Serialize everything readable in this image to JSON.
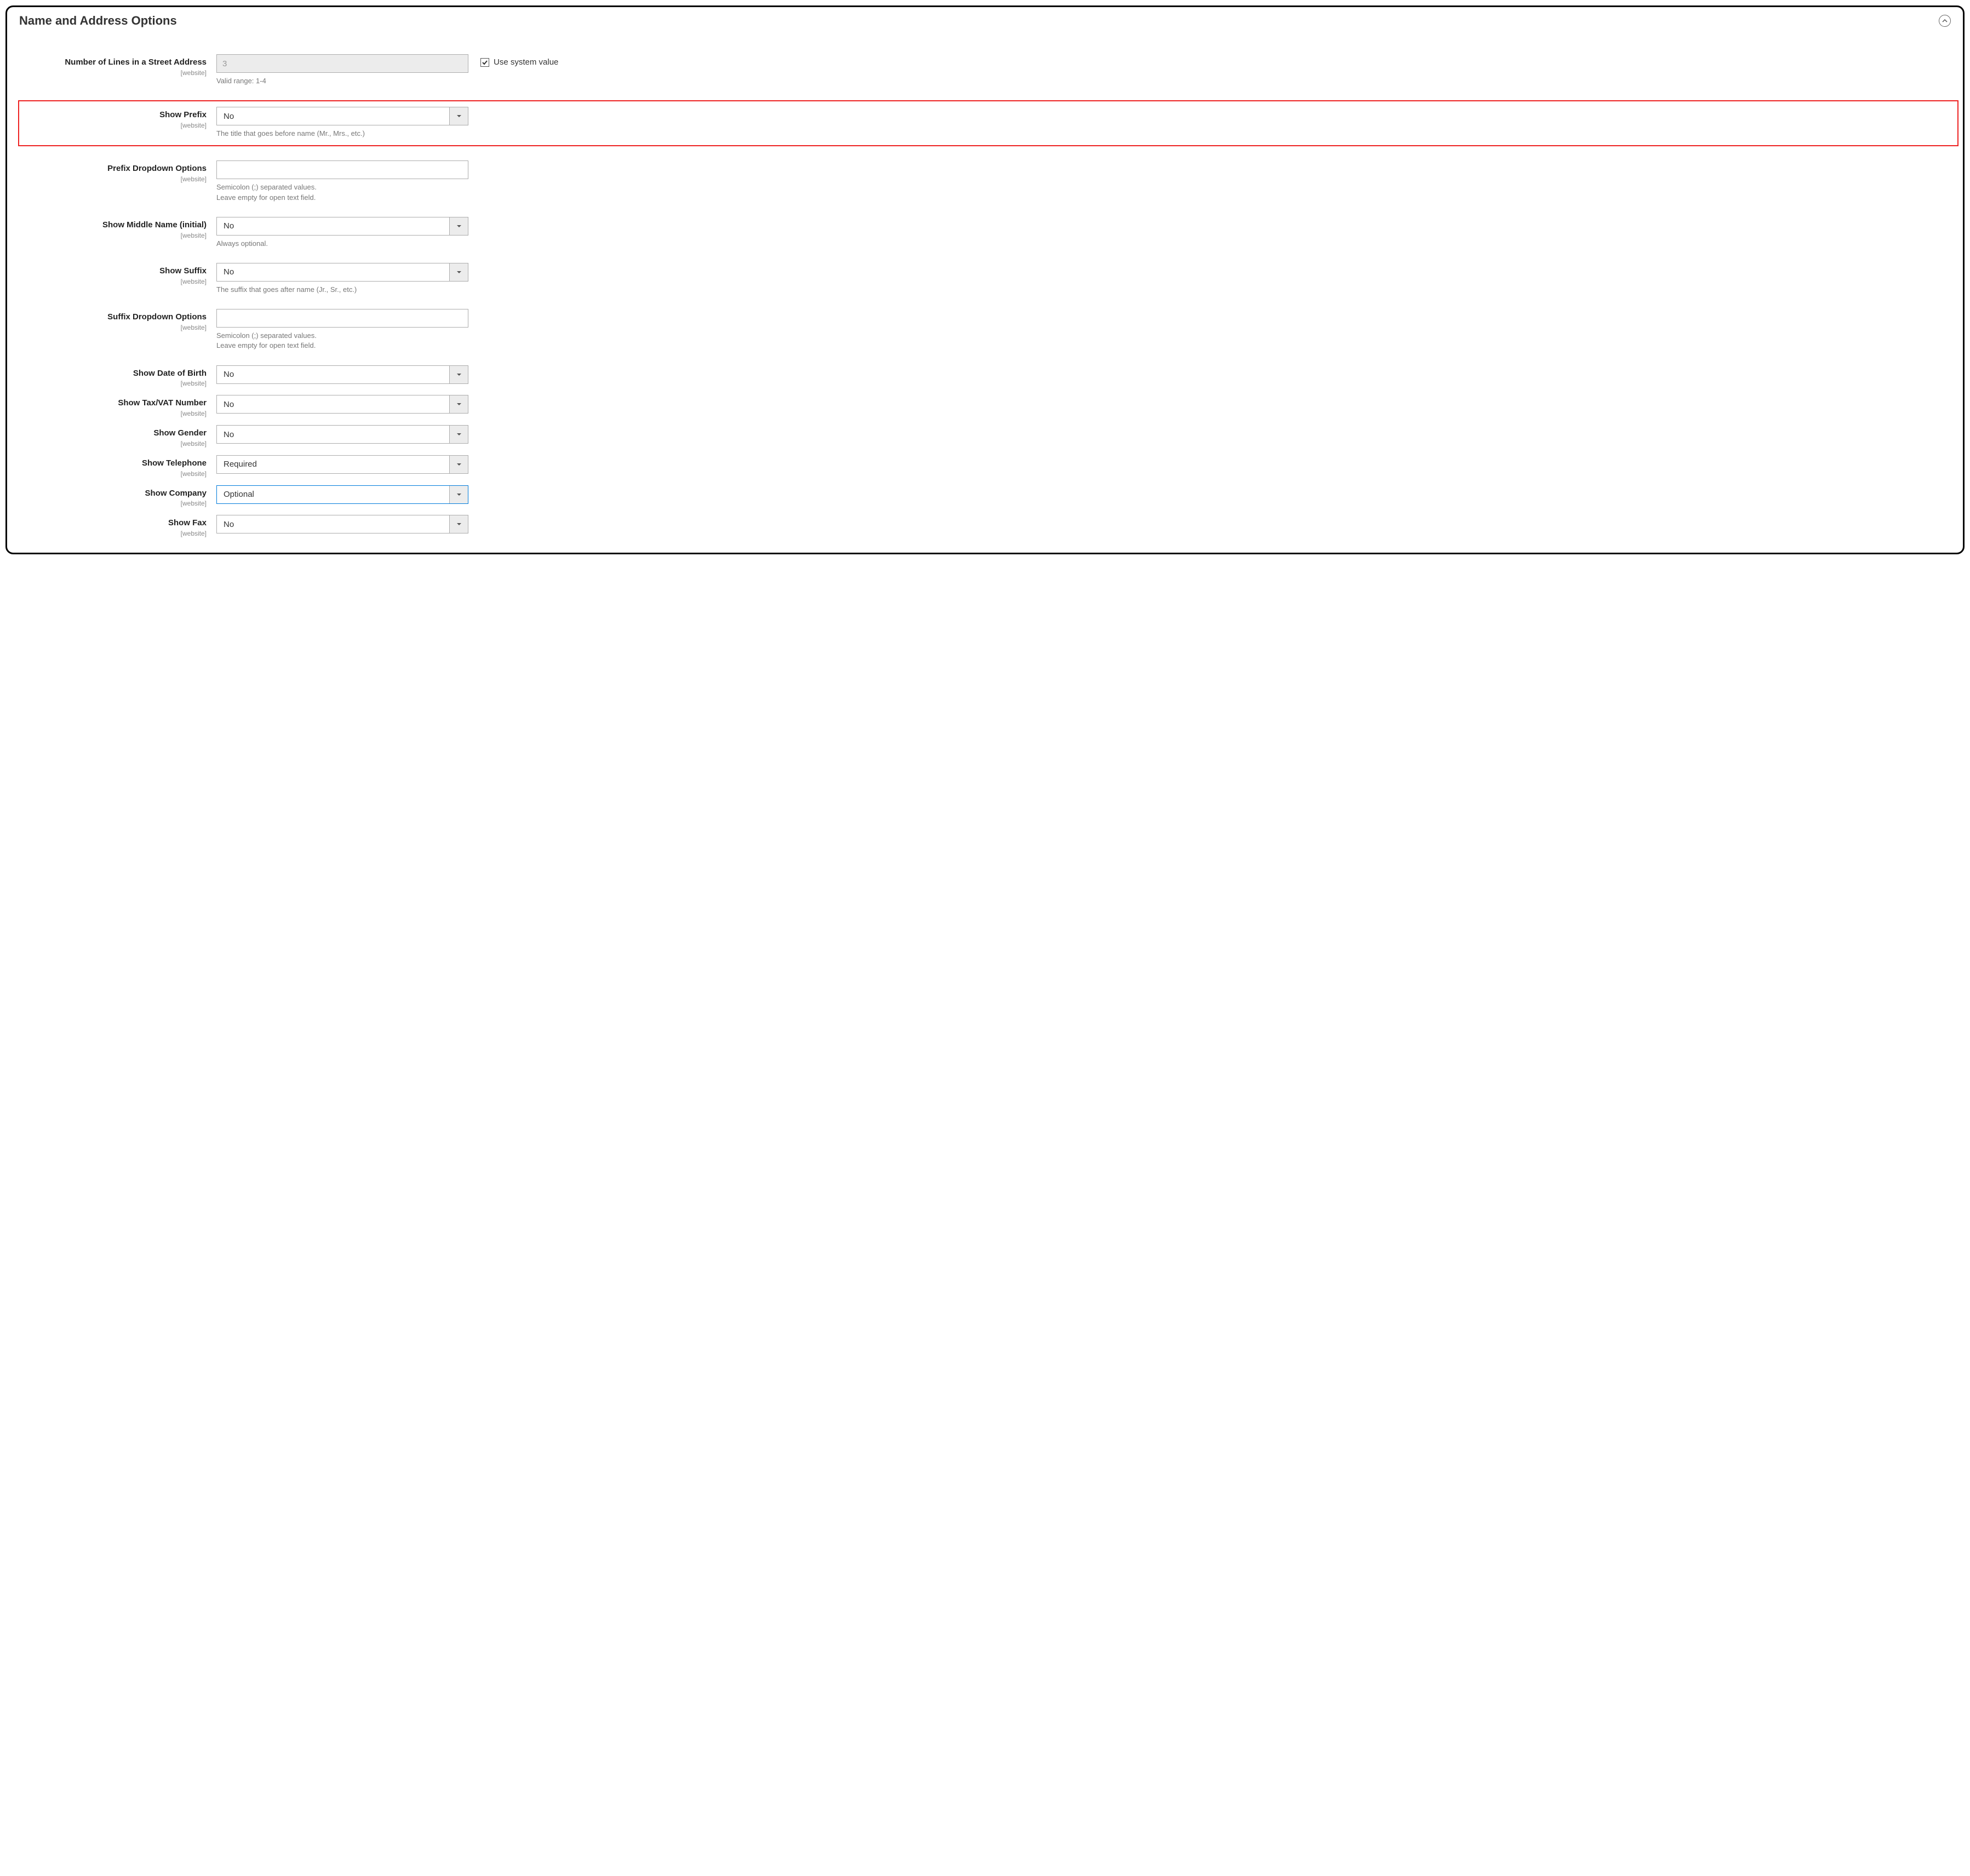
{
  "panel": {
    "title": "Name and Address Options"
  },
  "scope_label": "[website]",
  "use_system_value_label": "Use system value",
  "fields": {
    "street_lines": {
      "label": "Number of Lines in a Street Address",
      "value": "3",
      "helper": "Valid range: 1-4"
    },
    "show_prefix": {
      "label": "Show Prefix",
      "value": "No",
      "helper": "The title that goes before name (Mr., Mrs., etc.)"
    },
    "prefix_options": {
      "label": "Prefix Dropdown Options",
      "value": "",
      "helper1": "Semicolon (;) separated values.",
      "helper2": "Leave empty for open text field."
    },
    "show_middle_name": {
      "label": "Show Middle Name (initial)",
      "value": "No",
      "helper": "Always optional."
    },
    "show_suffix": {
      "label": "Show Suffix",
      "value": "No",
      "helper": "The suffix that goes after name (Jr., Sr., etc.)"
    },
    "suffix_options": {
      "label": "Suffix Dropdown Options",
      "value": "",
      "helper1": "Semicolon (;) separated values.",
      "helper2": "Leave empty for open text field."
    },
    "show_dob": {
      "label": "Show Date of Birth",
      "value": "No"
    },
    "show_taxvat": {
      "label": "Show Tax/VAT Number",
      "value": "No"
    },
    "show_gender": {
      "label": "Show Gender",
      "value": "No"
    },
    "show_telephone": {
      "label": "Show Telephone",
      "value": "Required"
    },
    "show_company": {
      "label": "Show Company",
      "value": "Optional"
    },
    "show_fax": {
      "label": "Show Fax",
      "value": "No"
    }
  }
}
